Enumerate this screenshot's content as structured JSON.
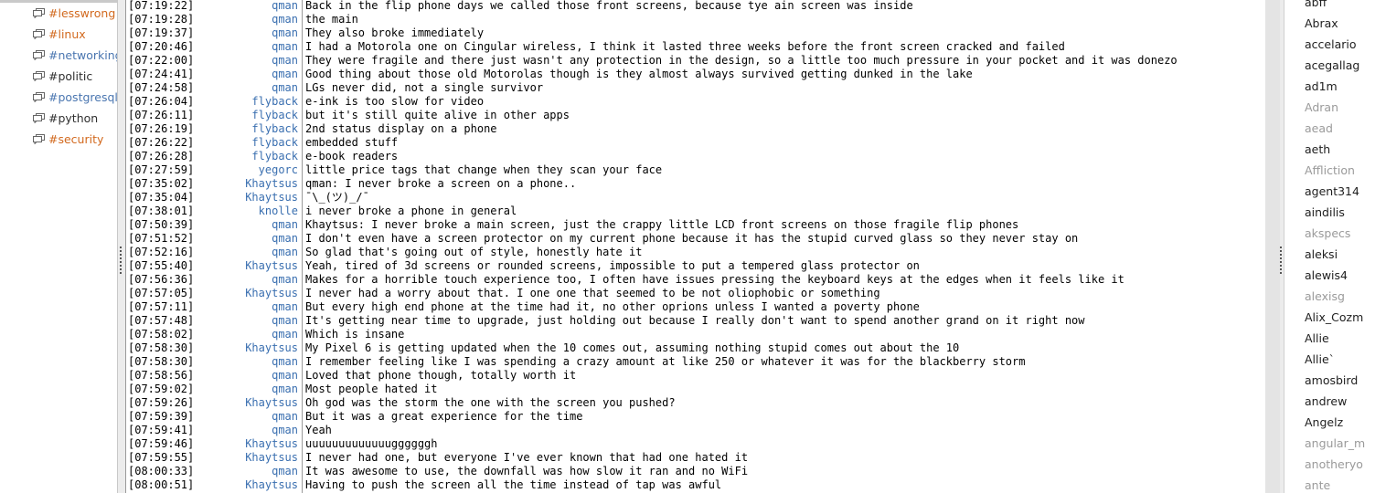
{
  "colors": {
    "nick": "#3a6fb0",
    "chan_active": "#d2691e",
    "chan_normal": "#2f2f2f",
    "chan_blue": "#4a76b0",
    "user_normal": "#1e1e1e",
    "user_away": "#9a9a9a"
  },
  "channels": [
    {
      "name": "#lesswrong",
      "state": "highlight",
      "icon": "chat-bubble-icon"
    },
    {
      "name": "#linux",
      "state": "highlight",
      "icon": "chat-bubble-icon"
    },
    {
      "name": "#networking",
      "state": "message",
      "icon": "chat-bubble-icon"
    },
    {
      "name": "#politic",
      "state": "normal",
      "icon": "chat-bubble-icon"
    },
    {
      "name": "#postgresql",
      "state": "message",
      "icon": "chat-bubble-icon"
    },
    {
      "name": "#python",
      "state": "normal",
      "icon": "chat-bubble-icon"
    },
    {
      "name": "#security",
      "state": "highlight",
      "icon": "chat-bubble-icon"
    }
  ],
  "messages": [
    {
      "time": "[07:19:22]",
      "nick": "qman",
      "text": "Back in the flip phone days we called those front screens, because tye ain screen was inside"
    },
    {
      "time": "[07:19:28]",
      "nick": "qman",
      "text": "the main"
    },
    {
      "time": "[07:19:37]",
      "nick": "qman",
      "text": "They also broke immediately"
    },
    {
      "time": "[07:20:46]",
      "nick": "qman",
      "text": "I had a Motorola one on Cingular wireless, I think it lasted three weeks before the front screen cracked and failed"
    },
    {
      "time": "[07:22:00]",
      "nick": "qman",
      "text": "They were fragile and there just wasn't any protection in the design, so a little too much pressure in your pocket and it was donezo"
    },
    {
      "time": "[07:24:41]",
      "nick": "qman",
      "text": "Good thing about those old Motorolas though is they almost always survived getting dunked in the lake"
    },
    {
      "time": "[07:24:58]",
      "nick": "qman",
      "text": "LGs never did, not a single survivor"
    },
    {
      "time": "[07:26:04]",
      "nick": "flyback",
      "text": "e-ink is too slow for video"
    },
    {
      "time": "[07:26:11]",
      "nick": "flyback",
      "text": "but it's still quite alive in other apps"
    },
    {
      "time": "[07:26:19]",
      "nick": "flyback",
      "text": "2nd status display on a phone"
    },
    {
      "time": "[07:26:22]",
      "nick": "flyback",
      "text": "embedded stuff"
    },
    {
      "time": "[07:26:28]",
      "nick": "flyback",
      "text": "e-book readers"
    },
    {
      "time": "[07:27:59]",
      "nick": "yegorc",
      "text": "little price tags that change when they scan your face"
    },
    {
      "time": "[07:35:02]",
      "nick": "Khaytsus",
      "text": "qman: I never broke a screen on a phone.."
    },
    {
      "time": "[07:35:04]",
      "nick": "Khaytsus",
      "text": "¯\\_(ツ)_/¯"
    },
    {
      "time": "[07:38:01]",
      "nick": "knolle",
      "text": "i never broke a phone in general"
    },
    {
      "time": "[07:50:39]",
      "nick": "qman",
      "text": "Khaytsus: I never broke a main screen, just the crappy little LCD front screens on those fragile flip phones"
    },
    {
      "time": "[07:51:52]",
      "nick": "qman",
      "text": "I don't even have a screen protector on my current phone because it has the stupid curved glass so they never stay on"
    },
    {
      "time": "[07:52:16]",
      "nick": "qman",
      "text": "So glad that's going out of style, honestly hate it"
    },
    {
      "time": "[07:55:40]",
      "nick": "Khaytsus",
      "text": "Yeah, tired of 3d screens or rounded screens, impossible to put a tempered glass protector on"
    },
    {
      "time": "[07:56:36]",
      "nick": "qman",
      "text": "Makes for a horrible touch experience too, I often have issues pressing the keyboard keys at the edges when it feels like it"
    },
    {
      "time": "[07:57:05]",
      "nick": "Khaytsus",
      "text": "I never had a worry about that.  I one one that seemed to be not oliophobic or something"
    },
    {
      "time": "[07:57:11]",
      "nick": "qman",
      "text": "But every high end phone at the time had it, no other oprions unless I wanted a poverty phone"
    },
    {
      "time": "[07:57:48]",
      "nick": "qman",
      "text": "It's getting near time to upgrade, just holding out because I really don't want to spend another grand on it right now"
    },
    {
      "time": "[07:58:02]",
      "nick": "qman",
      "text": "Which is insane"
    },
    {
      "time": "[07:58:30]",
      "nick": "Khaytsus",
      "text": "My Pixel 6 is getting updated when the 10 comes out, assuming nothing stupid comes out about the 10"
    },
    {
      "time": "[07:58:30]",
      "nick": "qman",
      "text": "I remember feeling like I was spending a crazy amount at like 250 or whatever it was for the blackberry storm"
    },
    {
      "time": "[07:58:56]",
      "nick": "qman",
      "text": "Loved that phone though, totally worth it"
    },
    {
      "time": "[07:59:02]",
      "nick": "qman",
      "text": "Most people hated it"
    },
    {
      "time": "[07:59:26]",
      "nick": "Khaytsus",
      "text": "Oh god was the storm the one with the screen you pushed?"
    },
    {
      "time": "[07:59:39]",
      "nick": "qman",
      "text": "But it was a great experience for the time"
    },
    {
      "time": "[07:59:41]",
      "nick": "qman",
      "text": "Yeah"
    },
    {
      "time": "[07:59:46]",
      "nick": "Khaytsus",
      "text": "uuuuuuuuuuuuuggggggh"
    },
    {
      "time": "[07:59:55]",
      "nick": "Khaytsus",
      "text": "I never had one, but everyone I've ever known that had one hated it"
    },
    {
      "time": "[08:00:33]",
      "nick": "qman",
      "text": "It was awesome to use, the downfall was how slow it ran and no WiFi"
    },
    {
      "time": "[08:00:51]",
      "nick": "Khaytsus",
      "text": "Having to push the screen all the time instead of tap was awful"
    }
  ],
  "users": [
    {
      "name": "abff",
      "away": false
    },
    {
      "name": "Abrax",
      "away": false
    },
    {
      "name": "accelario",
      "away": false
    },
    {
      "name": "acegallag",
      "away": false
    },
    {
      "name": "ad1m",
      "away": false
    },
    {
      "name": "Adran",
      "away": true
    },
    {
      "name": "aead",
      "away": true
    },
    {
      "name": "aeth",
      "away": false
    },
    {
      "name": "Affliction",
      "away": true
    },
    {
      "name": "agent314",
      "away": false
    },
    {
      "name": "aindilis",
      "away": false
    },
    {
      "name": "akspecs",
      "away": true
    },
    {
      "name": "aleksi",
      "away": false
    },
    {
      "name": "alewis4",
      "away": false
    },
    {
      "name": "alexisg",
      "away": true
    },
    {
      "name": "Alix_Cozm",
      "away": false
    },
    {
      "name": "Allie",
      "away": false
    },
    {
      "name": "Allie`",
      "away": false
    },
    {
      "name": "amosbird",
      "away": false
    },
    {
      "name": "andrew",
      "away": false
    },
    {
      "name": "Angelz",
      "away": false
    },
    {
      "name": "angular_m",
      "away": true
    },
    {
      "name": "anotheryo",
      "away": true
    },
    {
      "name": "ante",
      "away": true
    }
  ]
}
